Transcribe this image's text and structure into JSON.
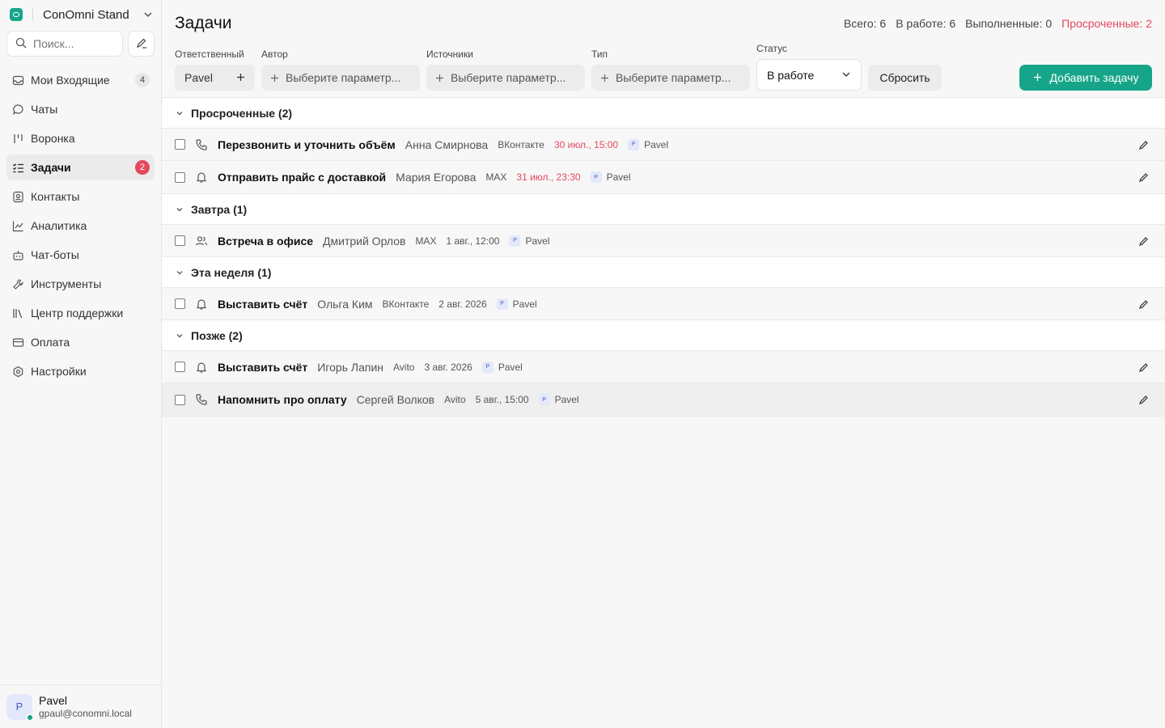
{
  "sidebar": {
    "workspace": "ConOmni Stand",
    "search_placeholder": "Поиск...",
    "items": [
      {
        "label": "Мои Входящие",
        "badge": "4"
      },
      {
        "label": "Чаты"
      },
      {
        "label": "Воронка"
      },
      {
        "label": "Задачи",
        "badge": "2"
      },
      {
        "label": "Контакты"
      },
      {
        "label": "Аналитика"
      },
      {
        "label": "Чат-боты"
      },
      {
        "label": "Инструменты"
      },
      {
        "label": "Центр поддержки"
      },
      {
        "label": "Оплата"
      },
      {
        "label": "Настройки"
      }
    ],
    "user": {
      "initial": "P",
      "name": "Pavel",
      "email": "gpaul@conomni.local"
    }
  },
  "header": {
    "title": "Задачи",
    "counters": {
      "total": "Всего: 6",
      "in_work": "В работе: 6",
      "done": "Выполненные: 0",
      "overdue": "Просроченные: 2"
    }
  },
  "filters": {
    "assignee": {
      "label": "Ответственный",
      "value": "Pavel"
    },
    "author": {
      "label": "Автор",
      "placeholder": "Выберите параметр..."
    },
    "sources": {
      "label": "Источники",
      "placeholder": "Выберите параметр..."
    },
    "type": {
      "label": "Тип",
      "placeholder": "Выберите параметр..."
    },
    "status": {
      "label": "Статус",
      "value": "В работе"
    },
    "reset": "Сбросить",
    "add_task": "Добавить задачу"
  },
  "groups": [
    {
      "title": "Просроченные (2)",
      "tasks": [
        {
          "icon": "phone-icon",
          "name": "Перезвонить и уточнить объём",
          "contact": "Анна Смирнова",
          "source": "ВКонтакте",
          "date": "30 июл., 15:00",
          "overdue": true,
          "assignee_initial": "P",
          "assignee": "Pavel"
        },
        {
          "icon": "bell-icon",
          "name": "Отправить прайс с доставкой",
          "contact": "Мария Егорова",
          "source": "MAX",
          "date": "31 июл., 23:30",
          "overdue": true,
          "assignee_initial": "P",
          "assignee": "Pavel"
        }
      ]
    },
    {
      "title": "Завтра (1)",
      "tasks": [
        {
          "icon": "users-icon",
          "name": "Встреча в офисе",
          "contact": "Дмитрий Орлов",
          "source": "MAX",
          "date": "1 авг., 12:00",
          "overdue": false,
          "assignee_initial": "P",
          "assignee": "Pavel"
        }
      ]
    },
    {
      "title": "Эта неделя (1)",
      "tasks": [
        {
          "icon": "bell-icon",
          "name": "Выставить счёт",
          "contact": "Ольга Ким",
          "source": "ВКонтакте",
          "date": "2 авг. 2026",
          "overdue": false,
          "assignee_initial": "P",
          "assignee": "Pavel"
        }
      ]
    },
    {
      "title": "Позже (2)",
      "tasks": [
        {
          "icon": "bell-icon",
          "name": "Выставить счёт",
          "contact": "Игорь Лапин",
          "source": "Avito",
          "date": "3 авг. 2026",
          "overdue": false,
          "assignee_initial": "P",
          "assignee": "Pavel"
        },
        {
          "icon": "phone-icon",
          "name": "Напомнить про оплату",
          "contact": "Сергей Волков",
          "source": "Avito",
          "date": "5 авг., 15:00",
          "overdue": false,
          "assignee_initial": "P",
          "assignee": "Pavel"
        }
      ]
    }
  ],
  "colors": {
    "accent": "#17a589",
    "danger": "#e5485d"
  }
}
